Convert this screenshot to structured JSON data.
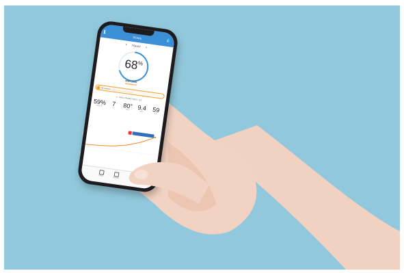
{
  "app": {
    "title": "SOME"
  },
  "nav": {
    "day_label": "TODAY",
    "prev_icon": "chevron-left-icon",
    "next_icon": "chevron-right-icon"
  },
  "gauge": {
    "value": "68",
    "unit": "%",
    "fraction": 0.68,
    "risk_label": "RISK LEVEL",
    "risk_level": "MODERATE",
    "color": "#3a8fd6"
  },
  "alert": {
    "text": "Be cautious  ................................................"
  },
  "location": {
    "name": "SAN FRANCISCO, CA"
  },
  "stats": [
    {
      "value": "59%",
      "label": "HUMIDITY"
    },
    {
      "value": "7",
      "label": "UV"
    },
    {
      "value": "80°",
      "label": "TEMP"
    },
    {
      "value": "9.4",
      "label": "WIND"
    },
    {
      "value": "59",
      "label": "AQI"
    }
  ],
  "bottom_nav": [
    {
      "label": "TODAY",
      "icon": "calendar-icon"
    },
    {
      "label": "HISTORY",
      "icon": "history-icon"
    }
  ],
  "colors": {
    "background": "#92c8dc",
    "accent": "#3a8fd6",
    "warning": "#e08a1e"
  }
}
